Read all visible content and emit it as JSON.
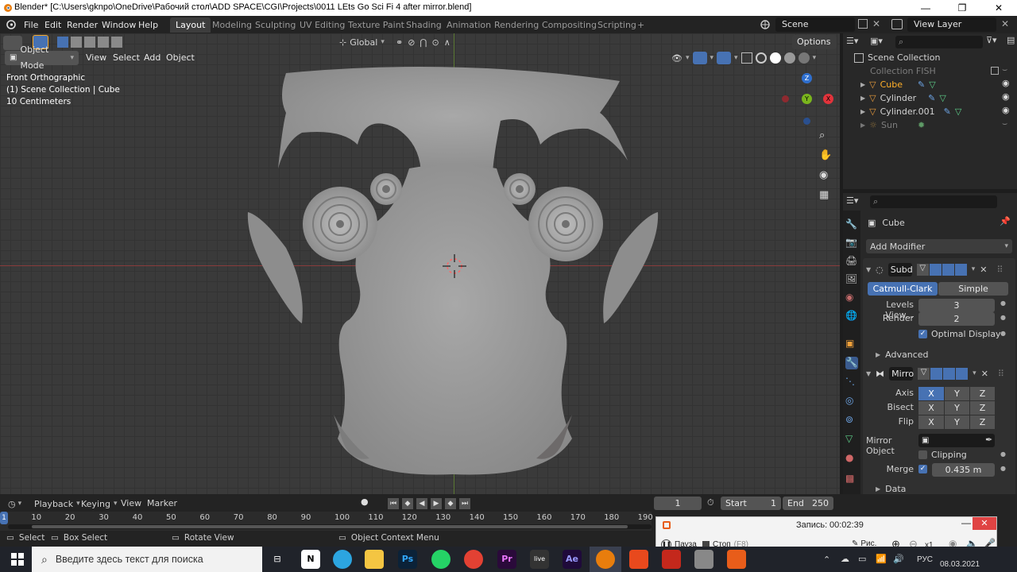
{
  "window": {
    "title": "Blender* [C:\\Users\\gknpo\\OneDrive\\Рабочий стол\\ADD SPACE\\CGI\\Projects\\0011 LEts Go Sci Fi 4 after mirror.blend]",
    "minimize": "—",
    "maximize": "❐",
    "close": "✕"
  },
  "menu": [
    "File",
    "Edit",
    "Render",
    "Window",
    "Help"
  ],
  "workspaces": [
    "Layout",
    "Modeling",
    "Sculpting",
    "UV Editing",
    "Texture Paint",
    "Shading",
    "Animation",
    "Rendering",
    "Compositing",
    "Scripting"
  ],
  "workspace_add": "+",
  "scene": {
    "name": "Scene",
    "view_layer": "View Layer"
  },
  "toolbar": {
    "transform_orientation": "Global",
    "options": "Options"
  },
  "viewport": {
    "mode": "Object Mode",
    "menus": [
      "View",
      "Select",
      "Add",
      "Object"
    ],
    "overlay_lines": [
      "Front Orthographic",
      "(1) Scene Collection | Cube",
      "10 Centimeters"
    ],
    "gizmo": {
      "z": "Z",
      "y": "Y",
      "x": "X"
    }
  },
  "outliner": {
    "root": "Scene Collection",
    "items": [
      {
        "label": "Collection FISH",
        "dim": true
      },
      {
        "label": "Cube",
        "dim": false
      },
      {
        "label": "Cylinder",
        "dim": false
      },
      {
        "label": "Cylinder.001",
        "dim": false
      },
      {
        "label": "Sun",
        "dim": true
      }
    ]
  },
  "properties": {
    "object_name": "Cube",
    "add_modifier": "Add Modifier",
    "subsurf": {
      "name": "Subd",
      "types": [
        "Catmull-Clark",
        "Simple"
      ],
      "levels_viewport_label": "Levels View...",
      "levels_viewport": "3",
      "render_label": "Render",
      "render": "2",
      "optimal_display": "Optimal Display",
      "advanced": "Advanced"
    },
    "mirror": {
      "name": "Mirro",
      "axis_label": "Axis",
      "bisect_label": "Bisect",
      "flip_label": "Flip",
      "axes": [
        "X",
        "Y",
        "Z"
      ],
      "mirror_object_label": "Mirror Object",
      "clipping": "Clipping",
      "merge_label": "Merge",
      "merge_value": "0.435 m",
      "data": "Data"
    }
  },
  "timeline": {
    "menus": [
      "Playback",
      "Keying",
      "View",
      "Marker"
    ],
    "current_frame": "1",
    "start_label": "Start",
    "start": "1",
    "end_label": "End",
    "end": "250",
    "ticks": [
      "10",
      "20",
      "30",
      "40",
      "50",
      "60",
      "70",
      "80",
      "90",
      "100",
      "110",
      "120",
      "130",
      "140",
      "150",
      "160",
      "170",
      "180",
      "190"
    ],
    "playhead": "1"
  },
  "statusbar": {
    "select": "Select",
    "box_select": "Box Select",
    "rotate_view": "Rotate View",
    "context_menu": "Object Context Menu"
  },
  "recorder": {
    "label": "Запись:",
    "time": "00:02:39",
    "pause": "Пауза",
    "stop": "Стоп",
    "stop_key": "(F8)",
    "draw": "Рис.",
    "zoom": "x1"
  },
  "taskbar": {
    "search_placeholder": "Введите здесь текст для поиска",
    "lang": "РУС",
    "date": "08.03.2021"
  }
}
